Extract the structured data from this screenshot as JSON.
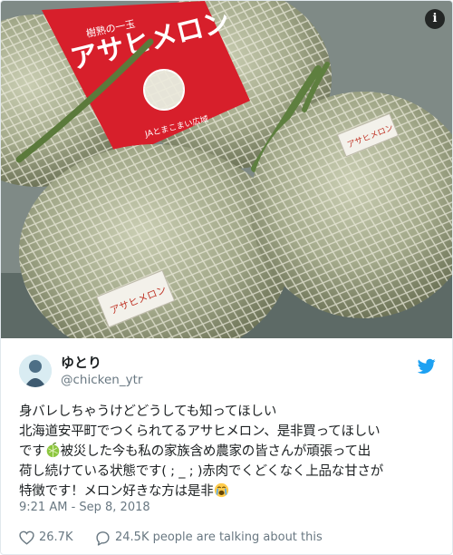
{
  "photo": {
    "alt_label_box_text": "アサヒメロン",
    "box_small_text": "JAとまこまい広域",
    "box_top_text": "樹熟の一玉",
    "sticker_text": "アサヒメロン"
  },
  "info_icon": "info-icon",
  "tweet": {
    "display_name": "ゆとり",
    "screen_name": "@chicken_ytr",
    "text_line1": "身バレしちゃうけどどうしても知ってほしい",
    "text_line2": "北海道安平町でつくられてるアサヒメロン、是非買ってほしい",
    "text_line3a": "です",
    "text_line3b": "被災した今も私の家族含め農家の皆さんが頑張って出",
    "text_line4": "荷し続けている状態です( ; _ ; )赤肉でくどくなく上品な甘さが",
    "text_line5a": "特徴です！メロン好きな方は是非",
    "timestamp": "9:21 AM - Sep 8, 2018",
    "likes": "26.7K",
    "talking": "24.5K people are talking about this"
  },
  "colors": {
    "twitter_blue": "#1da1f2",
    "text_secondary": "#697882",
    "box_red": "#d71f2b"
  }
}
